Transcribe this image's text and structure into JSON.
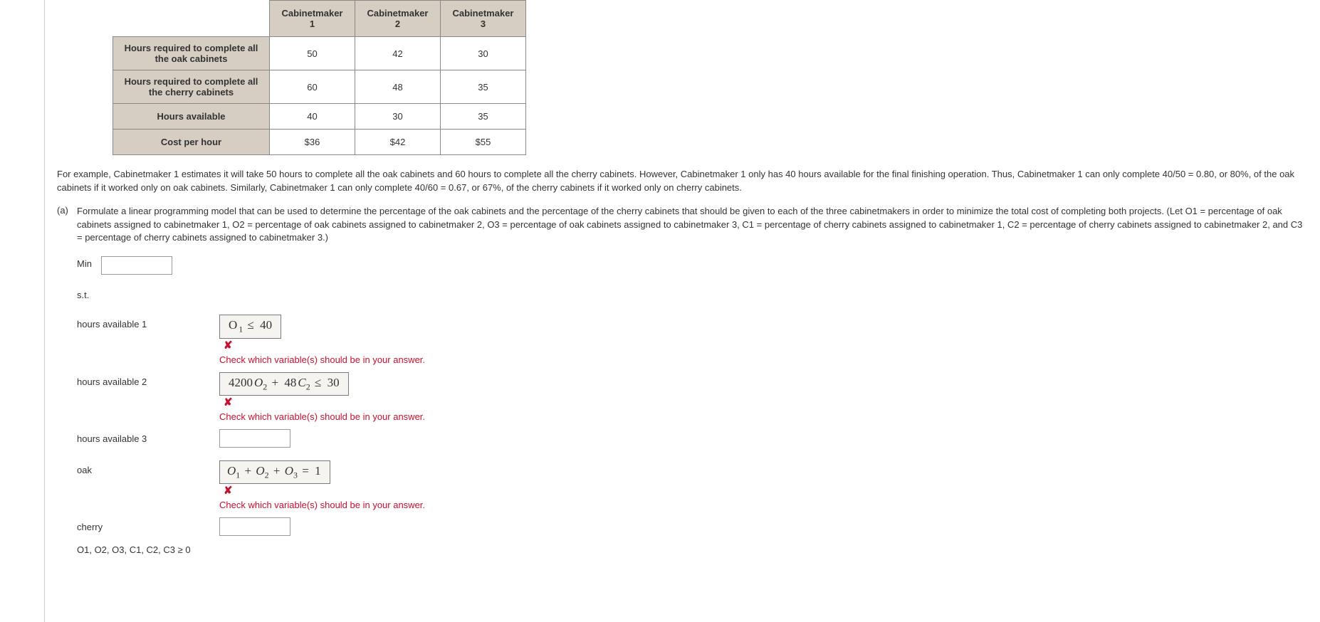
{
  "table": {
    "headers": [
      "Cabinetmaker 1",
      "Cabinetmaker 2",
      "Cabinetmaker 3"
    ],
    "rows": [
      {
        "label": "Hours required to complete all the oak cabinets",
        "c1": "50",
        "c2": "42",
        "c3": "30"
      },
      {
        "label": "Hours required to complete all the cherry cabinets",
        "c1": "60",
        "c2": "48",
        "c3": "35"
      },
      {
        "label": "Hours available",
        "c1": "40",
        "c2": "30",
        "c3": "35"
      },
      {
        "label": "Cost per hour",
        "c1": "$36",
        "c2": "$42",
        "c3": "$55"
      }
    ]
  },
  "paragraph": "For example, Cabinetmaker 1 estimates it will take 50 hours to complete all the oak cabinets and 60 hours to complete all the cherry cabinets. However, Cabinetmaker 1 only has 40 hours available for the final finishing operation. Thus, Cabinetmaker 1 can only complete 40/50 = 0.80, or 80%, of the oak cabinets if it worked only on oak cabinets. Similarly, Cabinetmaker 1 can only complete 40/60 = 0.67, or 67%, of the cherry cabinets if it worked only on cherry cabinets.",
  "question": {
    "part_label": "(a)",
    "text": "Formulate a linear programming model that can be used to determine the percentage of the oak cabinets and the percentage of the cherry cabinets that should be given to each of the three cabinetmakers in order to minimize the total cost of completing both projects. (Let O1 = percentage of oak cabinets assigned to cabinetmaker 1, O2 = percentage of oak cabinets assigned to cabinetmaker 2, O3 = percentage of oak cabinets assigned to cabinetmaker 3, C1 = percentage of cherry cabinets assigned to cabinetmaker 1, C2 = percentage of cherry cabinets assigned to cabinetmaker 2, and C3 = percentage of cherry cabinets assigned to cabinetmaker 3.)"
  },
  "form": {
    "min_label": "Min",
    "min_value": "",
    "st_label": "s.t.",
    "rows": {
      "h1": {
        "label": "hours available 1",
        "answer_html": "O<sub>1</sub> ≤ 40",
        "wrong": true
      },
      "h2": {
        "label": "hours available 2",
        "answer_html": "4200O<sub>2</sub> + 48C<sub>2</sub> ≤ 30",
        "wrong": true
      },
      "h3": {
        "label": "hours available 3",
        "answer_value": ""
      },
      "oak": {
        "label": "oak",
        "answer_html": "O<sub>1</sub> + O<sub>2</sub> + O<sub>3</sub> = 1",
        "wrong": true
      },
      "cherry": {
        "label": "cherry",
        "answer_value": ""
      }
    },
    "feedback_text": "Check which variable(s) should be in your answer.",
    "nonneg": "O1, O2, O3, C1, C2, C3 ≥ 0"
  }
}
